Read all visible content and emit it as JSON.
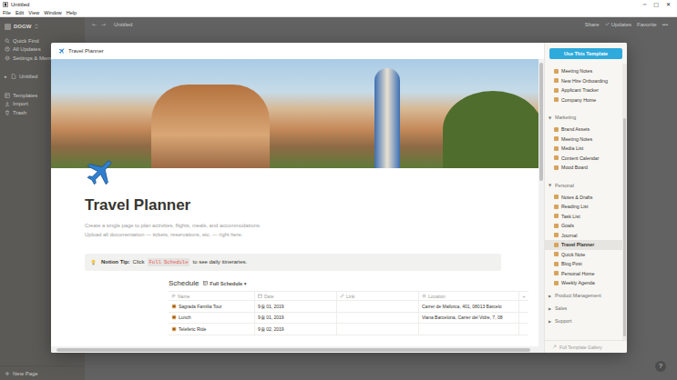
{
  "window": {
    "title": "Untitled",
    "controls": [
      "─",
      "□",
      "✕"
    ]
  },
  "menu": [
    "File",
    "Edit",
    "View",
    "Window",
    "Help"
  ],
  "sidebar": {
    "workspace": "DOGW",
    "items": [
      {
        "label": "Quick Find",
        "kind": "search"
      },
      {
        "label": "All Updates",
        "kind": "clock"
      },
      {
        "label": "Settings & Mem",
        "kind": "gear"
      }
    ],
    "pages": [
      {
        "label": "Untitled",
        "arrow": "▸"
      }
    ],
    "tools": [
      {
        "label": "Templates",
        "kind": "template"
      },
      {
        "label": "Import",
        "kind": "import"
      },
      {
        "label": "Trash",
        "kind": "trash"
      }
    ],
    "new_page": "New Page"
  },
  "topbar": {
    "nav": [
      "←",
      "→"
    ],
    "breadcrumb": "Untitled",
    "actions": [
      "Share",
      "Updates",
      "Favorite",
      "•••"
    ]
  },
  "preview": {
    "header": "Travel Planner",
    "title": "Travel Planner",
    "description": [
      "Create a single page to plan activities, flights, meals, and accommodations.",
      "Upload all documentation — tickets, reservations, etc. — right here."
    ],
    "callout": {
      "label": "Notion Tip:",
      "before": "Click",
      "code": "Full Schedule",
      "after": "to see daily itineraries."
    },
    "schedule": {
      "title": "Schedule",
      "view": "Full Schedule",
      "caret": "▾",
      "columns": [
        {
          "label": "Name",
          "kind": "title"
        },
        {
          "label": "Date",
          "kind": "date"
        },
        {
          "label": "Link",
          "kind": "url"
        },
        {
          "label": "Location",
          "kind": "text"
        }
      ],
      "add": "+",
      "rows": [
        {
          "name": "Sagrada Familia Tour",
          "date": "9월 01, 2019",
          "link": "",
          "location": "Carrer de Mallorca, 401, 08013 Barcelo"
        },
        {
          "name": "Lunch",
          "date": "9월 01, 2019",
          "link": "",
          "location": "Viana Barcelona, Carrer del Vidre, 7, 08"
        },
        {
          "name": "Teleferic Ride",
          "date": "9월 02, 2019",
          "link": "",
          "location": ""
        }
      ]
    }
  },
  "templates": {
    "button": "Use This Template",
    "top_items": [
      {
        "label": "Meeting Notes",
        "selected": false
      },
      {
        "label": "New Hire Onboarding",
        "selected": false
      },
      {
        "label": "Applicant Tracker",
        "selected": false
      },
      {
        "label": "Company Home",
        "selected": false
      }
    ],
    "groups": [
      {
        "title": "Marketing",
        "arrow": "▼",
        "expanded": true,
        "items": [
          {
            "label": "Brand Assets",
            "selected": false
          },
          {
            "label": "Meeting Notes",
            "selected": false
          },
          {
            "label": "Media List",
            "selected": false
          },
          {
            "label": "Content Calendar",
            "selected": false
          },
          {
            "label": "Mood Board",
            "selected": false
          }
        ]
      },
      {
        "title": "Personal",
        "arrow": "▼",
        "expanded": true,
        "items": [
          {
            "label": "Notes & Drafts",
            "selected": false
          },
          {
            "label": "Reading List",
            "selected": false
          },
          {
            "label": "Task List",
            "selected": false
          },
          {
            "label": "Goals",
            "selected": false
          },
          {
            "label": "Journal",
            "selected": false
          },
          {
            "label": "Travel Planner",
            "selected": true
          },
          {
            "label": "Quick Note",
            "selected": false
          },
          {
            "label": "Blog Post",
            "selected": false
          },
          {
            "label": "Personal Home",
            "selected": false
          },
          {
            "label": "Weekly Agenda",
            "selected": false
          }
        ]
      },
      {
        "title": "Product Management",
        "arrow": "▶",
        "expanded": false,
        "items": []
      },
      {
        "title": "Sales",
        "arrow": "▶",
        "expanded": false,
        "items": []
      },
      {
        "title": "Support",
        "arrow": "▶",
        "expanded": false,
        "items": []
      }
    ],
    "footer": "Full Template Gallery"
  },
  "help": "?"
}
